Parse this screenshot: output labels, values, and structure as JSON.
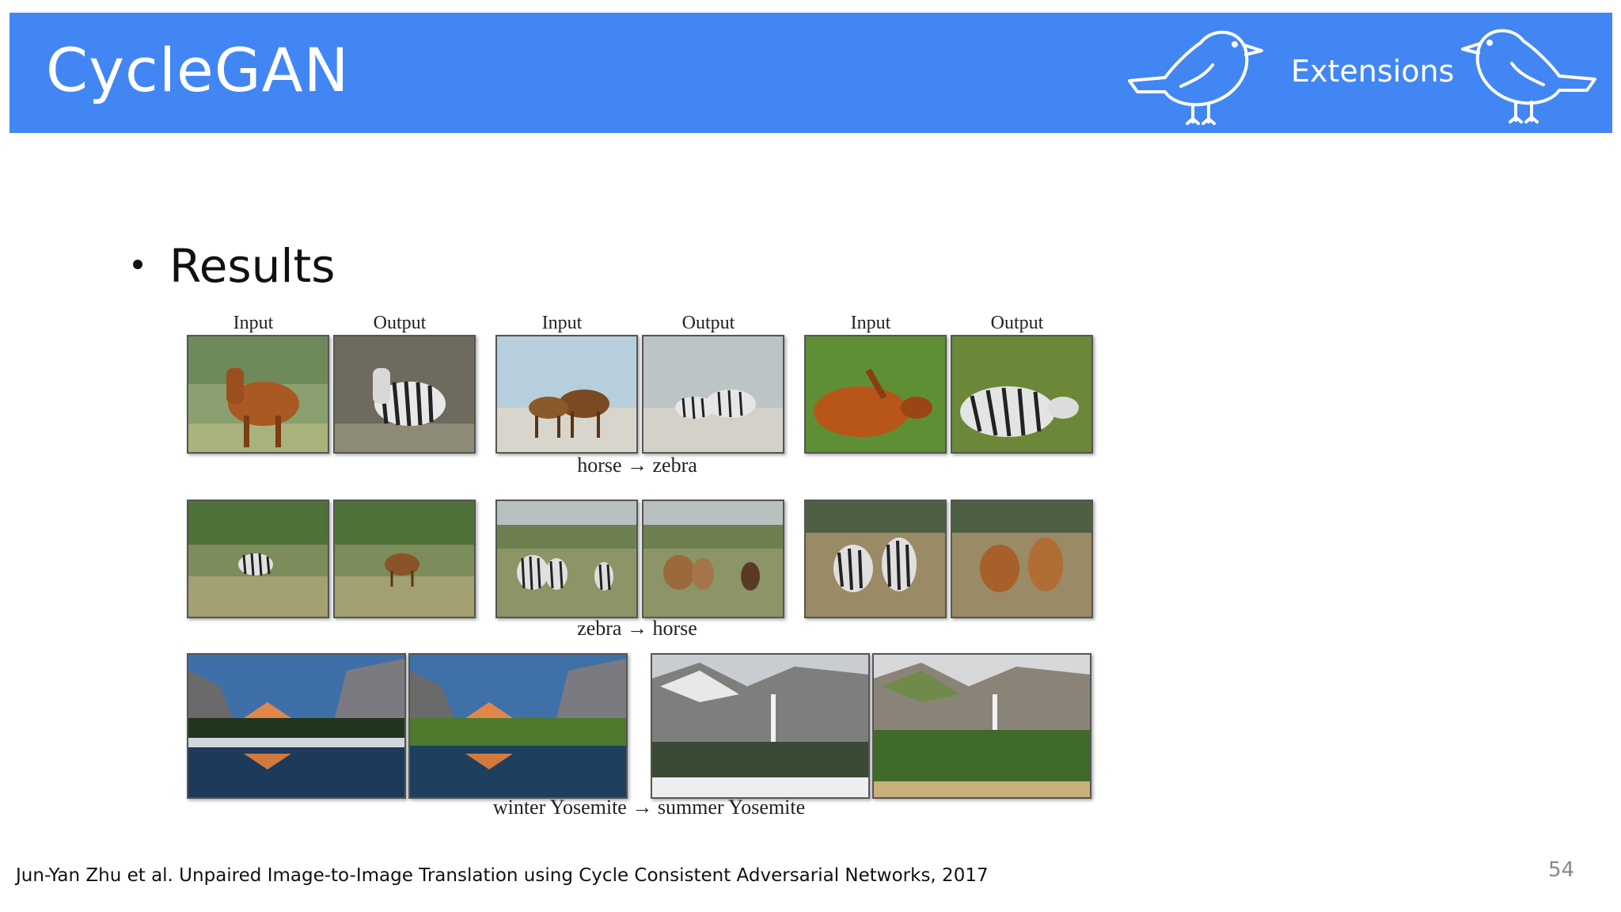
{
  "slide": {
    "title": "CycleGAN",
    "section": "Extensions",
    "bullet": "Results",
    "citation": "Jun-Yan Zhu et al. Unpaired Image-to-Image Translation using Cycle Consistent Adversarial Networks, 2017",
    "page_number": "54",
    "header_color": "#4286f4"
  },
  "figure": {
    "column_labels": [
      "Input",
      "Output",
      "Input",
      "Output",
      "Input",
      "Output"
    ],
    "captions": [
      "horse → zebra",
      "zebra → horse",
      "winter Yosemite → summer Yosemite"
    ],
    "icons": [
      "bird-icon-left",
      "bird-icon-right"
    ]
  }
}
